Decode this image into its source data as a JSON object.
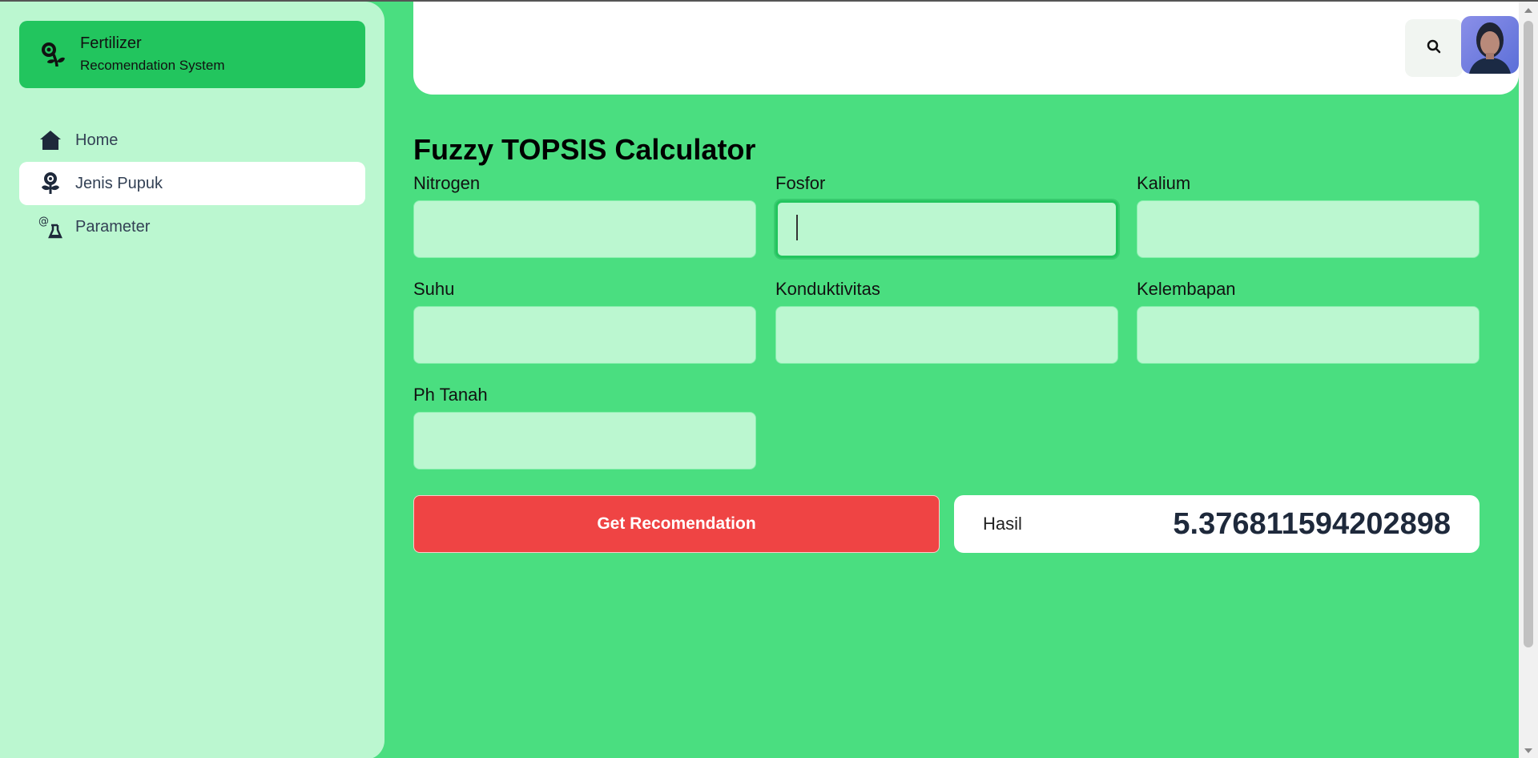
{
  "brand": {
    "title": "Fertilizer",
    "subtitle": "Recomendation System",
    "icon": "seedling-icon"
  },
  "sidebar": {
    "items": [
      {
        "label": "Home",
        "icon": "home-icon",
        "active": false
      },
      {
        "label": "Jenis Pupuk",
        "icon": "plant-icon",
        "active": true
      },
      {
        "label": "Parameter",
        "icon": "flask-icon",
        "active": false
      }
    ]
  },
  "topbar": {
    "search_icon": "search-icon",
    "avatar": "user-avatar"
  },
  "page": {
    "title": "Fuzzy TOPSIS Calculator"
  },
  "form": {
    "fields": [
      {
        "label": "Nitrogen",
        "value": ""
      },
      {
        "label": "Fosfor",
        "value": ""
      },
      {
        "label": "Kalium",
        "value": ""
      },
      {
        "label": "Suhu",
        "value": ""
      },
      {
        "label": "Konduktivitas",
        "value": ""
      },
      {
        "label": "Kelembapan",
        "value": ""
      },
      {
        "label": "Ph Tanah",
        "value": ""
      }
    ]
  },
  "actions": {
    "recommend_label": "Get Recomendation"
  },
  "result": {
    "label": "Hasil",
    "value": "5.376811594202898"
  },
  "colors": {
    "background": "#4ade80",
    "sidebar": "#bbf7d0",
    "brand": "#22c55e",
    "button": "#ef4444"
  }
}
